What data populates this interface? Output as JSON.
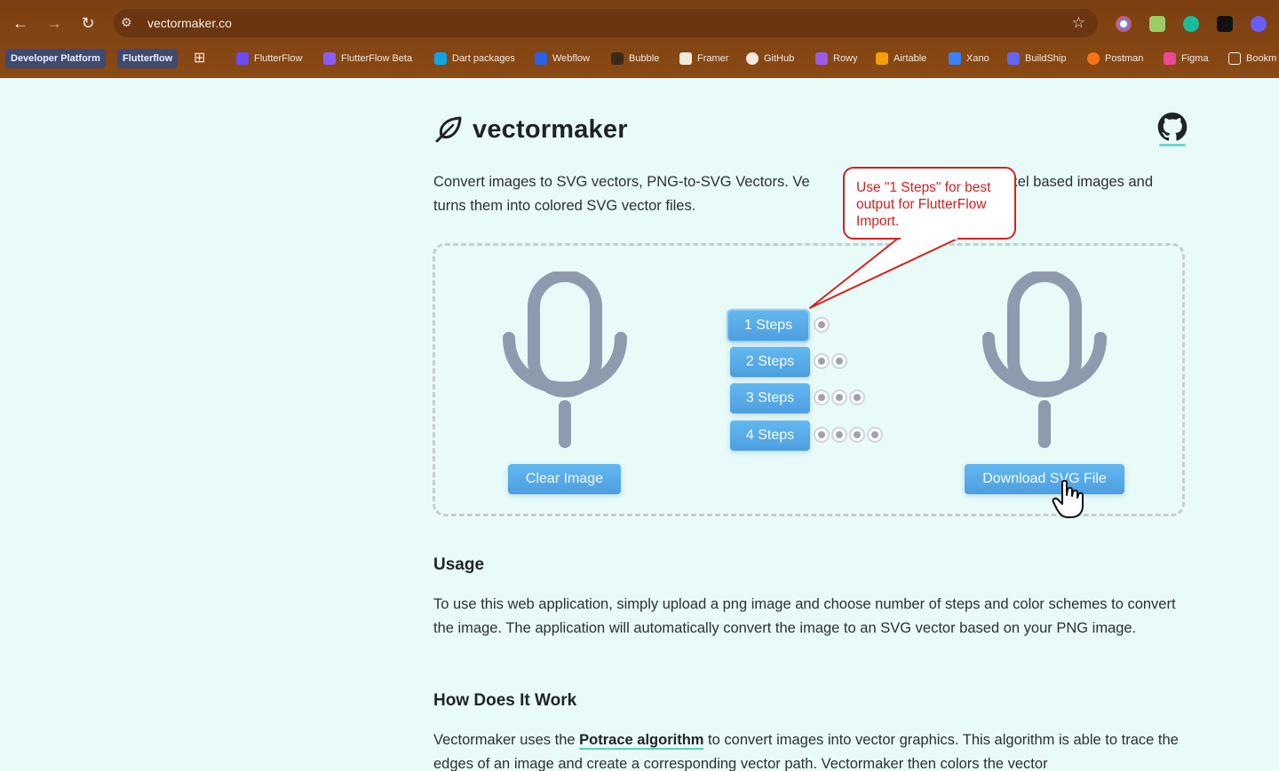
{
  "browser": {
    "url": "vectormaker.co",
    "bookmarks": [
      {
        "label": "Developer Platform",
        "pill": true
      },
      {
        "label": "Flutterflow",
        "pill": true
      },
      {
        "label": "FlutterFlow",
        "color": "#6b4cf6"
      },
      {
        "label": "FlutterFlow Beta",
        "color": "#8b5cf6"
      },
      {
        "label": "Dart packages",
        "color": "#0ea5e9"
      },
      {
        "label": "Webflow",
        "color": "#2563eb"
      },
      {
        "label": "Bubble",
        "color": "#333333"
      },
      {
        "label": "Framer",
        "color": "#ffffff"
      },
      {
        "label": "GitHub",
        "color": "#ffffff"
      },
      {
        "label": "Rowy",
        "color": "#9b5de5"
      },
      {
        "label": "Airtable",
        "color": "#f59e0b"
      },
      {
        "label": "Xano",
        "color": "#3b82f6"
      },
      {
        "label": "BuildShip",
        "color": "#6366f1"
      },
      {
        "label": "Postman",
        "color": "#f97316"
      },
      {
        "label": "Figma",
        "color": "#ec4899"
      },
      {
        "label": "Bookm",
        "color": "#f4e9df"
      }
    ]
  },
  "page": {
    "logo_text": "vectormaker",
    "intro_part1": "Convert images to SVG vectors, PNG-to-SVG Vectors. Ve",
    "intro_part2": "pixel based images and turns them into colored SVG vector files.",
    "clear_button": "Clear Image",
    "download_button": "Download SVG File",
    "steps": [
      {
        "label": "1 Steps",
        "dots": 1
      },
      {
        "label": "2 Steps",
        "dots": 2
      },
      {
        "label": "3 Steps",
        "dots": 3
      },
      {
        "label": "4 Steps",
        "dots": 4
      }
    ],
    "usage_heading": "Usage",
    "usage_text": "To use this web application, simply upload a png image and choose number of steps and color schemes to convert the image. The application will automatically convert the image to an SVG vector based on your PNG image.",
    "how_heading": "How Does It Work",
    "how_text_before": "Vectormaker uses the ",
    "how_link": "Potrace algorithm",
    "how_text_after": " to convert images into vector graphics. This algorithm is able to trace the edges of an image and create a corresponding vector path. Vectormaker then colors the vector"
  },
  "annotation": {
    "text": "Use \"1 Steps\" for best output for FlutterFlow Import.",
    "color": "#d62020"
  }
}
